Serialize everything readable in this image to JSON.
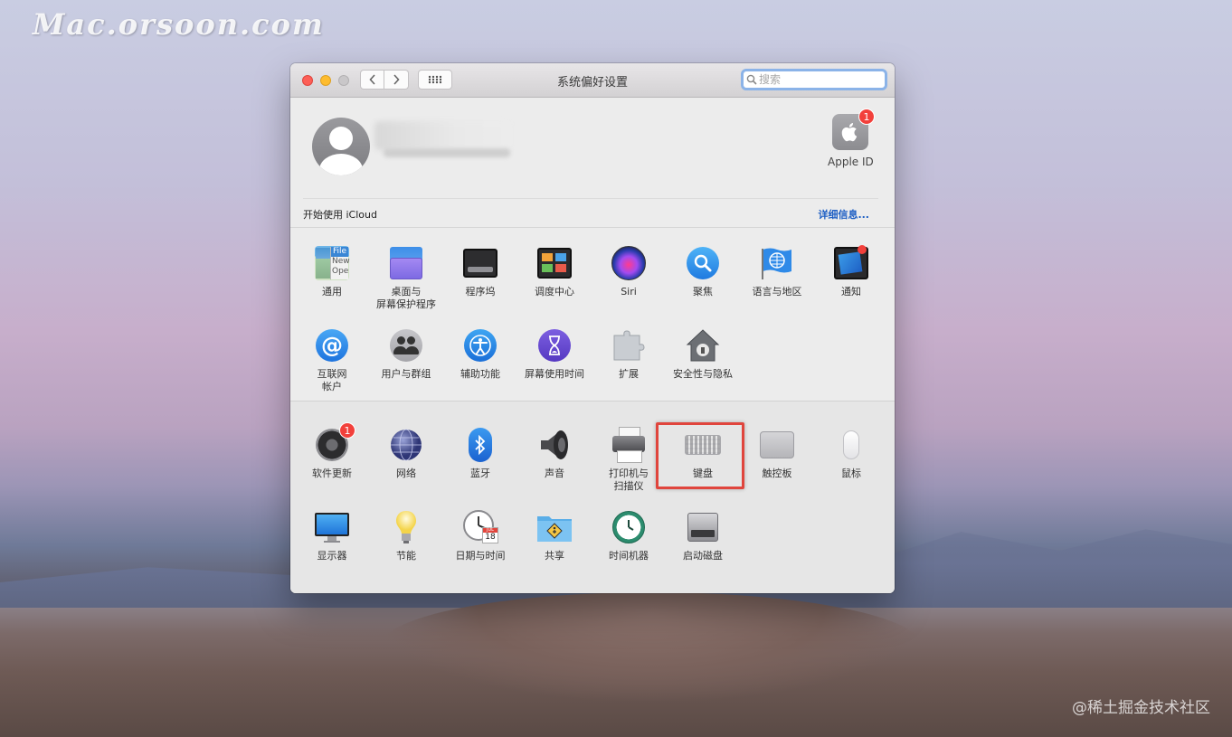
{
  "watermark": "Mac.orsoon.com",
  "credit": "@稀土掘金技术社区",
  "window": {
    "title": "系统偏好设置",
    "search_placeholder": "搜索"
  },
  "account": {
    "apple_id_label": "Apple ID",
    "apple_id_badge": "1",
    "icloud_prompt": "开始使用 iCloud",
    "details_link": "详细信息..."
  },
  "panes_row1": [
    {
      "label": "通用",
      "icon": "general-icon"
    },
    {
      "label": "桌面与\n屏幕保护程序",
      "icon": "desktop-screensaver-icon"
    },
    {
      "label": "程序坞",
      "icon": "dock-icon"
    },
    {
      "label": "调度中心",
      "icon": "mission-control-icon"
    },
    {
      "label": "Siri",
      "icon": "siri-icon"
    },
    {
      "label": "聚焦",
      "icon": "spotlight-icon"
    },
    {
      "label": "语言与地区",
      "icon": "language-region-icon"
    },
    {
      "label": "通知",
      "icon": "notifications-icon"
    }
  ],
  "panes_row2": [
    {
      "label": "互联网\n帐户",
      "icon": "internet-accounts-icon"
    },
    {
      "label": "用户与群组",
      "icon": "users-groups-icon"
    },
    {
      "label": "辅助功能",
      "icon": "accessibility-icon"
    },
    {
      "label": "屏幕使用时间",
      "icon": "screen-time-icon"
    },
    {
      "label": "扩展",
      "icon": "extensions-icon"
    },
    {
      "label": "安全性与隐私",
      "icon": "security-privacy-icon"
    }
  ],
  "panes_row3": [
    {
      "label": "软件更新",
      "icon": "software-update-icon",
      "badge": "1"
    },
    {
      "label": "网络",
      "icon": "network-icon"
    },
    {
      "label": "蓝牙",
      "icon": "bluetooth-icon"
    },
    {
      "label": "声音",
      "icon": "sound-icon"
    },
    {
      "label": "打印机与\n扫描仪",
      "icon": "printers-scanners-icon"
    },
    {
      "label": "键盘",
      "icon": "keyboard-icon"
    },
    {
      "label": "触控板",
      "icon": "trackpad-icon"
    },
    {
      "label": "鼠标",
      "icon": "mouse-icon"
    }
  ],
  "panes_row4": [
    {
      "label": "显示器",
      "icon": "displays-icon"
    },
    {
      "label": "节能",
      "icon": "energy-saver-icon"
    },
    {
      "label": "日期与时间",
      "icon": "date-time-icon"
    },
    {
      "label": "共享",
      "icon": "sharing-icon"
    },
    {
      "label": "时间机器",
      "icon": "time-machine-icon"
    },
    {
      "label": "启动磁盘",
      "icon": "startup-disk-icon"
    }
  ],
  "calendar_icon_text": {
    "month": "JUL",
    "day": "18"
  },
  "general_icon_text": {
    "line1": "File",
    "line2": "New",
    "line3": "Ope"
  },
  "colors": {
    "highlight": "#e0453d",
    "badge": "#f2403b",
    "link": "#1e5fc4"
  }
}
